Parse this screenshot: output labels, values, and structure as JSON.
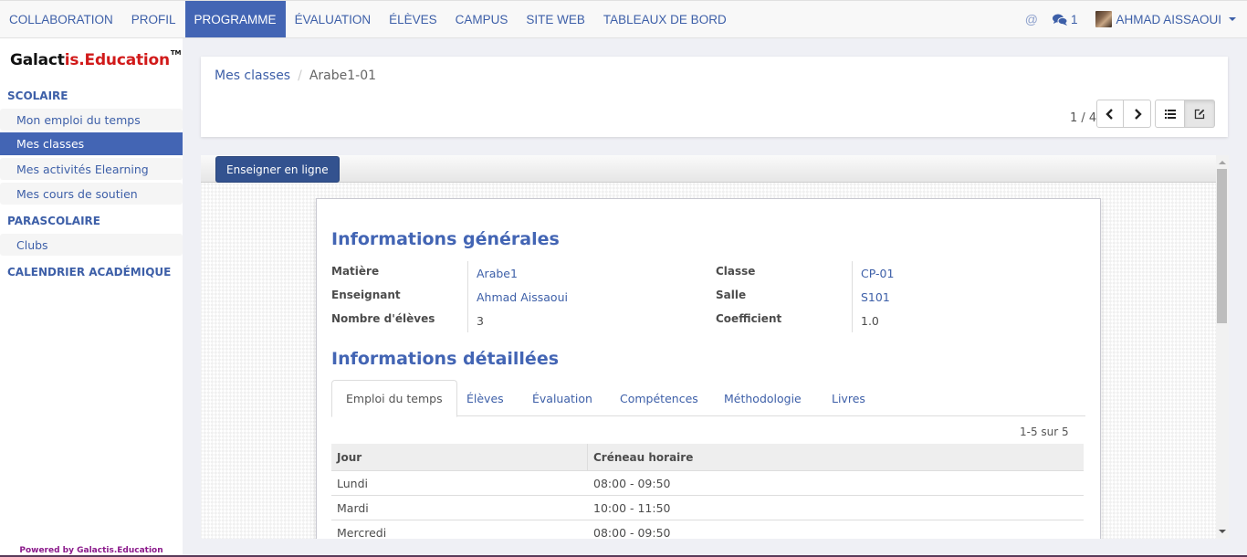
{
  "topbar": {
    "menu": [
      {
        "label": "COLLABORATION",
        "active": false
      },
      {
        "label": "PROFIL",
        "active": false
      },
      {
        "label": "PROGRAMME",
        "active": true
      },
      {
        "label": "ÉVALUATION",
        "active": false
      },
      {
        "label": "ÉLÈVES",
        "active": false
      },
      {
        "label": "CAMPUS",
        "active": false
      },
      {
        "label": "SITE WEB",
        "active": false
      },
      {
        "label": "TABLEAUX DE BORD",
        "active": false
      }
    ],
    "mention_icon": "@",
    "chat_count": "1",
    "user_name": "AHMAD AISSAOUI"
  },
  "sidebar": {
    "logo": {
      "part1": "Galact",
      "part2": "is.Education",
      "tm": "TM"
    },
    "sections": [
      {
        "title": "SCOLAIRE",
        "items": [
          {
            "label": "Mon emploi du temps",
            "active": false
          },
          {
            "label": "Mes classes",
            "active": true
          },
          {
            "label": "Mes activités Elearning",
            "active": false
          },
          {
            "label": "Mes cours de soutien",
            "active": false
          }
        ]
      },
      {
        "title": "PARASCOLAIRE",
        "items": [
          {
            "label": "Clubs",
            "active": false
          }
        ]
      },
      {
        "title": "CALENDRIER ACADÉMIQUE",
        "items": []
      }
    ],
    "powered_by": "Powered by Galactis.Education"
  },
  "control": {
    "breadcrumb": {
      "parent": "Mes classes",
      "separator": "/",
      "current": "Arabe1-01"
    },
    "pager": "1 / 4"
  },
  "form": {
    "primary_button": "Enseigner en ligne",
    "general_title": "Informations générales",
    "fields_left": [
      {
        "label": "Matière",
        "value": "Arabe1",
        "link": true
      },
      {
        "label": "Enseignant",
        "value": "Ahmad Aissaoui",
        "link": true
      },
      {
        "label": "Nombre d'élèves",
        "value": "3",
        "link": false
      }
    ],
    "fields_right": [
      {
        "label": "Classe",
        "value": "CP-01",
        "link": true
      },
      {
        "label": "Salle",
        "value": "S101",
        "link": true
      },
      {
        "label": "Coefficient",
        "value": "1.0",
        "link": false
      }
    ],
    "detail_title": "Informations détaillées",
    "tabs": [
      {
        "label": "Emploi du temps",
        "active": true
      },
      {
        "label": "Élèves",
        "active": false
      },
      {
        "label": "Évaluation",
        "active": false
      },
      {
        "label": "Compétences",
        "active": false
      },
      {
        "label": "Méthodologie",
        "active": false
      },
      {
        "label": "Livres",
        "active": false
      }
    ],
    "record_count": "1-5 sur 5",
    "table": {
      "headers": [
        "Jour",
        "Créneau horaire"
      ],
      "rows": [
        [
          "Lundi",
          "08:00 - 09:50"
        ],
        [
          "Mardi",
          "10:00 - 11:50"
        ],
        [
          "Mercredi",
          "08:00 - 09:50"
        ]
      ]
    }
  },
  "colors": {
    "brand_blue": "#4365b4",
    "link_blue": "#3d5fa8",
    "primary_button": "#33528f",
    "logo_red": "#d11a1a",
    "powered_by": "#8b1a8b"
  }
}
